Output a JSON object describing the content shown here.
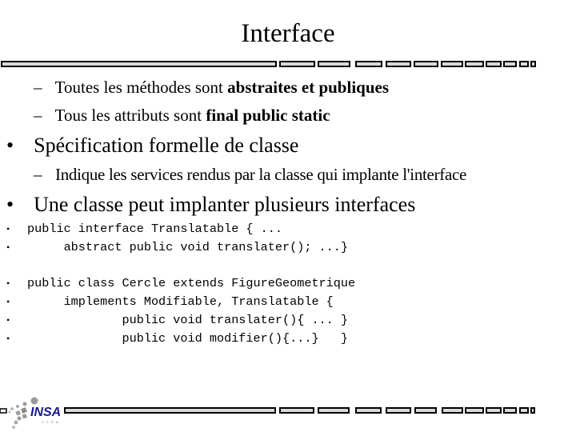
{
  "slide": {
    "title": "Interface",
    "sub_items_1": [
      {
        "dash": "–",
        "plain": "Toutes les méthodes sont ",
        "bold": "abstraites et publiques"
      },
      {
        "dash": "–",
        "plain": "Tous les attributs sont ",
        "bold": "final public static"
      }
    ],
    "bullet_1": {
      "marker": "•",
      "text": "Spécification formelle de classe"
    },
    "sub_items_2": [
      {
        "dash": "–",
        "text": "Indique les services rendus par la classe qui implante l'interface"
      }
    ],
    "bullet_2": {
      "marker": "•",
      "text": "Une classe peut implanter plusieurs interfaces"
    },
    "code_block_1": [
      {
        "marker": "•",
        "text": "public interface Translatable { ..."
      },
      {
        "marker": "•",
        "text": "     abstract public void translater(); ...}"
      }
    ],
    "code_block_2": [
      {
        "marker": "•",
        "text": "public class Cercle extends FigureGeometrique"
      },
      {
        "marker": "•",
        "text": "     implements Modifiable, Translatable {"
      },
      {
        "marker": "•",
        "text": "             public void translater(){ ... }"
      },
      {
        "marker": "•",
        "text": "             public void modifier(){...}   }"
      }
    ],
    "footer": {
      "logo_text": "INSA",
      "logo_subtext": "LYON",
      "logo_color": "#1a1a8c"
    }
  }
}
